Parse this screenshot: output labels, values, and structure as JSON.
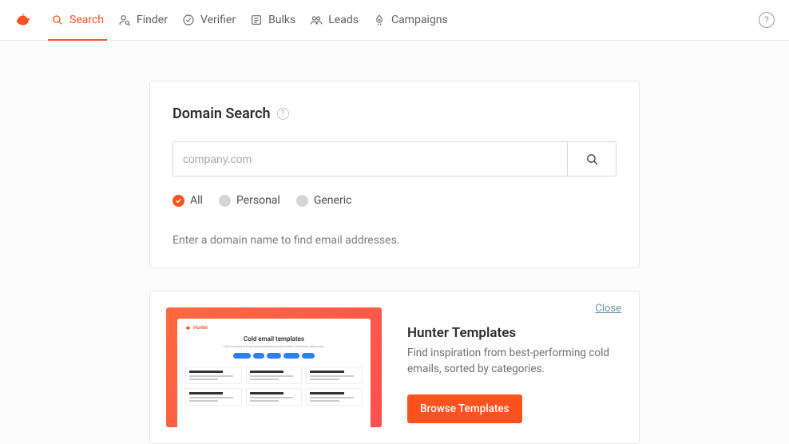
{
  "nav": {
    "items": [
      {
        "label": "Search",
        "icon": "search-icon"
      },
      {
        "label": "Finder",
        "icon": "finder-icon"
      },
      {
        "label": "Verifier",
        "icon": "verifier-icon"
      },
      {
        "label": "Bulks",
        "icon": "bulks-icon"
      },
      {
        "label": "Leads",
        "icon": "leads-icon"
      },
      {
        "label": "Campaigns",
        "icon": "campaigns-icon"
      }
    ],
    "active_index": 0
  },
  "help_glyph": "?",
  "domain_search": {
    "title": "Domain Search",
    "help_glyph": "?",
    "placeholder": "company.com",
    "value": "",
    "hint": "Enter a domain name to find email addresses.",
    "filters": [
      {
        "label": "All",
        "checked": true
      },
      {
        "label": "Personal",
        "checked": false
      },
      {
        "label": "Generic",
        "checked": false
      }
    ]
  },
  "promo": {
    "close_label": "Close",
    "title": "Hunter Templates",
    "description": "Find inspiration from best-performing cold emails, sorted by categories.",
    "cta": "Browse Templates",
    "preview": {
      "brand": "Hunter",
      "heading": "Cold email templates",
      "sub": "Find inspiration from best performing cold emails, sorted by categories."
    }
  },
  "colors": {
    "accent": "#fa5320"
  }
}
